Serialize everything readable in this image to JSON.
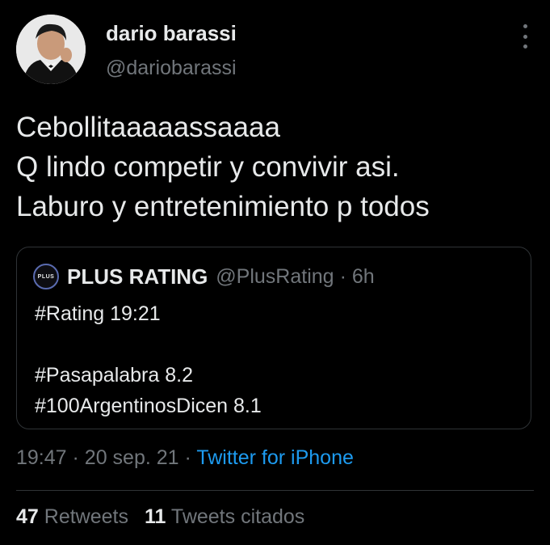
{
  "author": {
    "display_name": "dario barassi",
    "handle": "@dariobarassi"
  },
  "menu_icon": "more-vertical-icon",
  "tweet": {
    "lines": [
      "Cebollitaaaaassaaaa",
      "Q lindo competir y convivir asi.",
      "Laburo y entretenimiento p todos"
    ]
  },
  "quoted_tweet": {
    "avatar_text": "PLUS",
    "display_name": "PLUS RATING",
    "handle": "@PlusRating",
    "separator": "·",
    "time": "6h",
    "lines": [
      "#Rating 19:21",
      "",
      "#Pasapalabra 8.2",
      "#100ArgentinosDicen 8.1"
    ]
  },
  "meta": {
    "time": "19:47",
    "separator": "·",
    "date": "20 sep. 21",
    "source": "Twitter for iPhone"
  },
  "stats": {
    "retweets_count": "47",
    "retweets_label": "Retweets",
    "quotes_count": "11",
    "quotes_label": "Tweets citados"
  },
  "colors": {
    "background": "#000000",
    "text": "#e7e9ea",
    "secondary": "#71767b",
    "link": "#1d9bf0",
    "border": "#2f3336"
  }
}
